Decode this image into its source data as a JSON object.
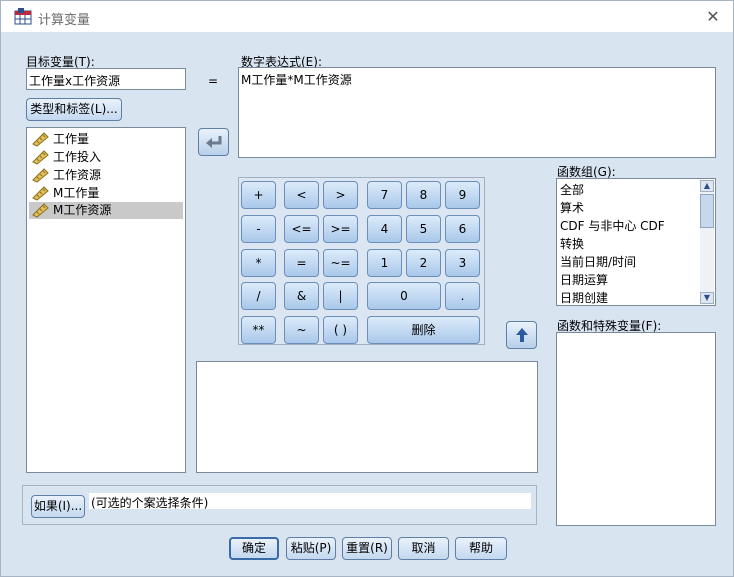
{
  "window": {
    "title": "计算变量",
    "close": "✕"
  },
  "target": {
    "label": "目标变量(T):",
    "value": "工作量x工作资源"
  },
  "equals": "=",
  "expr": {
    "label": "数字表达式(E):",
    "value": "M工作量*M工作资源"
  },
  "type_label_button": "类型和标签(L)...",
  "variables": [
    "工作量",
    "工作投入",
    "工作资源",
    "M工作量",
    "M工作资源"
  ],
  "keypad": {
    "plus": "+",
    "lt": "<",
    "gt": ">",
    "k7": "7",
    "k8": "8",
    "k9": "9",
    "minus": "-",
    "le": "<=",
    "ge": ">=",
    "k4": "4",
    "k5": "5",
    "k6": "6",
    "mul": "*",
    "eq": "=",
    "ne": "~=",
    "k1": "1",
    "k2": "2",
    "k3": "3",
    "div": "/",
    "and": "&",
    "or": "|",
    "k0": "0",
    "dot": ".",
    "pow": "**",
    "not": "~",
    "paren": "( )",
    "delete": "删除"
  },
  "function_group": {
    "label": "函数组(G):",
    "items": [
      "全部",
      "算术",
      "CDF 与非中心 CDF",
      "转换",
      "当前日期/时间",
      "日期运算",
      "日期创建"
    ]
  },
  "functions_label": "函数和特殊变量(F):",
  "if_section": {
    "button": "如果(I)...",
    "text": "(可选的个案选择条件)"
  },
  "buttons": {
    "ok": "确定",
    "paste": "粘贴(P)",
    "reset": "重置(R)",
    "cancel": "取消",
    "help": "帮助"
  },
  "icons": {
    "move_arrow": "arrow-left-icon",
    "up_arrow": "arrow-up-icon",
    "variable": "scale-ruler-icon"
  }
}
